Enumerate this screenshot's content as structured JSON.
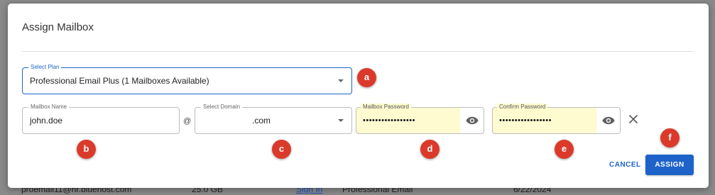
{
  "background_row": {
    "email": "proemail11@hr.bluehost.com",
    "size": "25.0 GB",
    "link": "Sign In",
    "plan": "Professional Email",
    "date": "6/22/2024"
  },
  "dialog": {
    "title": "Assign Mailbox",
    "plan_select": {
      "label": "Select Plan",
      "value": "Professional Email Plus (1 Mailboxes Available)"
    },
    "mailbox_name": {
      "label": "Mailbox Name",
      "value": "john.doe"
    },
    "at_symbol": "@",
    "domain_select": {
      "label": "Select Domain",
      "value": ".com"
    },
    "mailbox_password": {
      "label": "Mailbox Password",
      "value": "•••••••••••••••••"
    },
    "confirm_password": {
      "label": "Confirm Password",
      "value": "•••••••••••••••••"
    },
    "buttons": {
      "cancel": "CANCEL",
      "assign": "ASSIGN"
    }
  },
  "markers": [
    "a",
    "b",
    "c",
    "d",
    "e",
    "f"
  ],
  "colors": {
    "primary": "#1d63c9",
    "marker": "#db3a2b",
    "autofill": "#fdfbcf"
  }
}
